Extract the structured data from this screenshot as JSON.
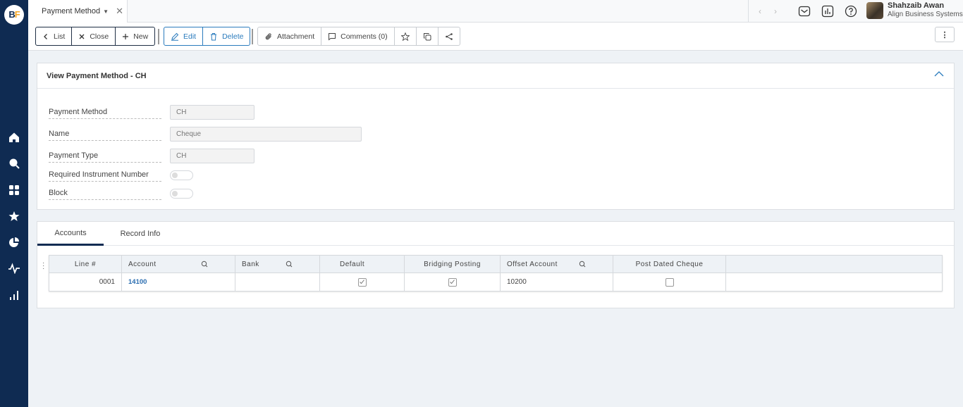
{
  "app": {
    "logo": {
      "b": "B",
      "f": "F"
    }
  },
  "sidebar": {
    "icons": [
      "home-icon",
      "search-icon",
      "apps-icon",
      "star-icon",
      "pie-chart-icon",
      "activity-icon",
      "bar-chart-icon"
    ]
  },
  "topbar": {
    "tab_label": "Payment Method",
    "tab_close": "✕",
    "nav_prev": "‹",
    "nav_next": "›",
    "user_name": "Shahzaib Awan",
    "user_company": "Align Business Systems"
  },
  "toolbar": {
    "list": "List",
    "close": "Close",
    "new": "New",
    "edit": "Edit",
    "delete": "Delete",
    "attachment": "Attachment",
    "comments": "Comments (0)",
    "more": "⋮"
  },
  "form": {
    "title": "View Payment Method - CH",
    "fields": {
      "payment_method": {
        "label": "Payment Method",
        "value": "CH"
      },
      "name": {
        "label": "Name",
        "value": "Cheque"
      },
      "payment_type": {
        "label": "Payment Type",
        "value": "CH"
      },
      "required_instrument_number": {
        "label": "Required Instrument Number",
        "checked": false
      },
      "block": {
        "label": "Block",
        "checked": false
      }
    }
  },
  "detail_tabs": [
    {
      "label": "Accounts",
      "active": true
    },
    {
      "label": "Record Info",
      "active": false
    }
  ],
  "grid": {
    "columns": [
      "Line #",
      "Account",
      "Bank",
      "Default",
      "Bridging Posting",
      "Offset Account",
      "Post Dated Cheque"
    ],
    "rows": [
      {
        "line": "0001",
        "account": "14100",
        "bank": "",
        "default": true,
        "bridging_posting": true,
        "offset_account": "10200",
        "post_dated_cheque": false
      }
    ]
  }
}
